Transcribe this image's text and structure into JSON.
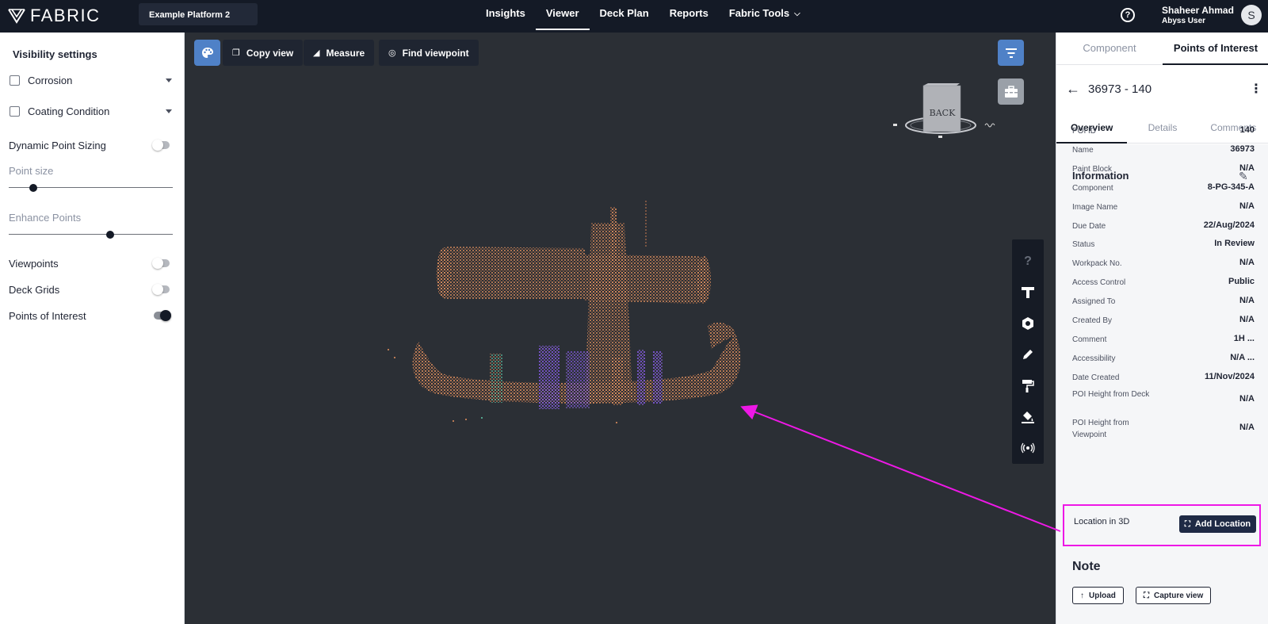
{
  "app": {
    "brand": "FABRIC",
    "platform": "Example Platform 2"
  },
  "nav": {
    "items": [
      "Insights",
      "Viewer",
      "Deck Plan",
      "Reports",
      "Fabric Tools"
    ],
    "active": "Viewer"
  },
  "user": {
    "name": "Shaheer Ahmad",
    "role": "Abyss User",
    "initial": "S"
  },
  "help_icon": "?",
  "left_panel": {
    "title": "Visibility settings",
    "checkboxes": [
      {
        "label": "Corrosion",
        "checked": false
      },
      {
        "label": "Coating Condition",
        "checked": false
      }
    ],
    "dynamic_point_sizing": {
      "label": "Dynamic Point Sizing",
      "on": false
    },
    "point_size": {
      "label": "Point size",
      "value": 0.15
    },
    "enhance_points": {
      "label": "Enhance Points",
      "value": 0.62
    },
    "toggles": [
      {
        "label": "Viewpoints",
        "on": false
      },
      {
        "label": "Deck Grids",
        "on": false
      },
      {
        "label": "Points of Interest",
        "on": true
      }
    ]
  },
  "viewer": {
    "toolbar": {
      "copy_view": "Copy view",
      "measure": "Measure",
      "find_viewpoint": "Find viewpoint"
    },
    "nav_cube_label": "BACK",
    "side_tools": [
      "help-icon",
      "tee-icon",
      "hexagon-icon",
      "pencil-icon",
      "paint-roller-icon",
      "paint-bucket-icon",
      "broadcast-icon"
    ],
    "side_help_glyph": "?",
    "colors": {
      "cloud_main": "#e8935f",
      "cloud_purple": "#8a5cf0",
      "cloud_teal": "#5fc7a8"
    }
  },
  "right_panel": {
    "tabs": [
      "Component",
      "Points of Interest"
    ],
    "active_tab": "Points of Interest",
    "poi_title": "36973 - 140",
    "subtabs": [
      "Overview",
      "Details",
      "Comments"
    ],
    "active_subtab": "Overview",
    "info_title": "Information",
    "rows": [
      {
        "key": "POI ID",
        "value": "140"
      },
      {
        "key": "Name",
        "value": "36973"
      },
      {
        "key": "Paint Block",
        "value": "N/A"
      },
      {
        "key": "Component",
        "value": "8-PG-345-A"
      },
      {
        "key": "Image Name",
        "value": "N/A"
      },
      {
        "key": "Due Date",
        "value": "22/Aug/2024"
      },
      {
        "key": "Status",
        "value": "In Review"
      },
      {
        "key": "Workpack No.",
        "value": "N/A"
      },
      {
        "key": "Access Control",
        "value": "Public"
      },
      {
        "key": "Assigned To",
        "value": "N/A"
      },
      {
        "key": "Created By",
        "value": "N/A"
      },
      {
        "key": "Comment",
        "value": "1H ..."
      },
      {
        "key": "Accessibility",
        "value": "N/A ..."
      },
      {
        "key": "Date Created",
        "value": "11/Nov/2024"
      },
      {
        "key": "POI Height from Deck",
        "value": "N/A"
      },
      {
        "key": "POI Height from Viewpoint",
        "value": "N/A"
      }
    ],
    "location": {
      "label": "Location in 3D",
      "button": "Add Location"
    },
    "note_title": "Note",
    "upload": "Upload",
    "capture_view": "Capture view"
  },
  "annotation": {
    "color": "#ee18e6"
  }
}
